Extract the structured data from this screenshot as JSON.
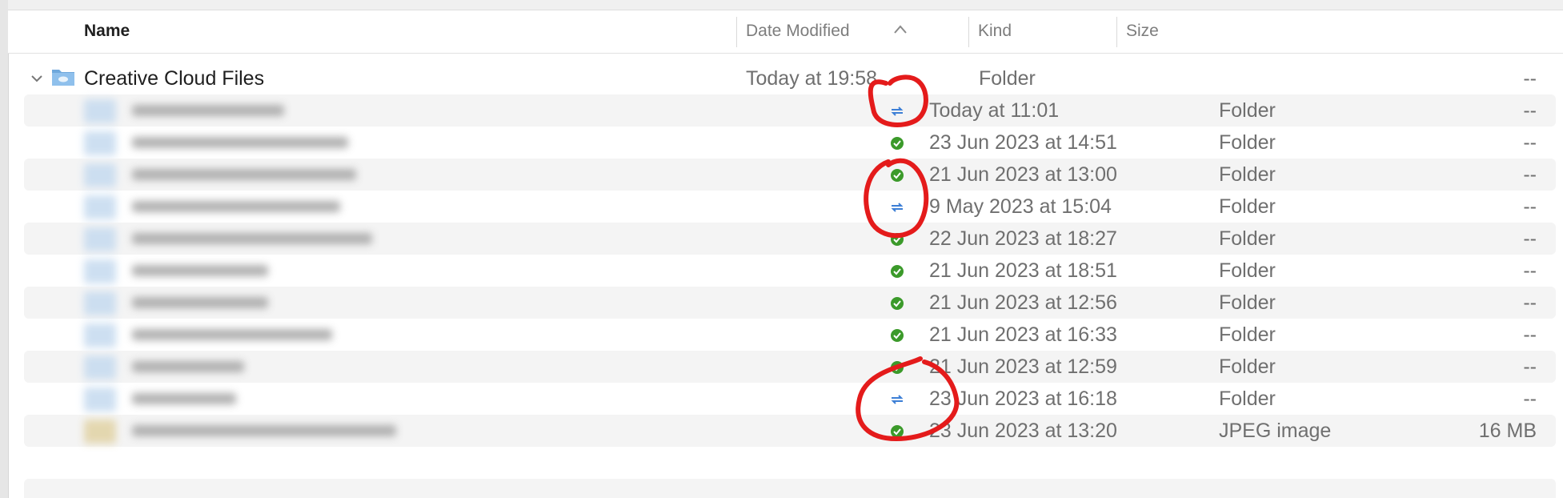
{
  "columns": {
    "name": "Name",
    "date_modified": "Date Modified",
    "kind": "Kind",
    "size": "Size",
    "sort_indicator": "^"
  },
  "root": {
    "name": "Creative Cloud Files",
    "date": "Today at 19:58",
    "kind": "Folder",
    "size": "--",
    "disclosure": "⌄",
    "icon": "cloud-folder-icon"
  },
  "rows": [
    {
      "status": "syncing",
      "date": "Today at 11:01",
      "kind": "Folder",
      "size": "--"
    },
    {
      "status": "synced",
      "date": "23 Jun 2023 at 14:51",
      "kind": "Folder",
      "size": "--"
    },
    {
      "status": "synced",
      "date": "21 Jun 2023 at 13:00",
      "kind": "Folder",
      "size": "--"
    },
    {
      "status": "syncing",
      "date": "9 May 2023 at 15:04",
      "kind": "Folder",
      "size": "--"
    },
    {
      "status": "synced",
      "date": "22 Jun 2023 at 18:27",
      "kind": "Folder",
      "size": "--"
    },
    {
      "status": "synced",
      "date": "21 Jun 2023 at 18:51",
      "kind": "Folder",
      "size": "--"
    },
    {
      "status": "synced",
      "date": "21 Jun 2023 at 12:56",
      "kind": "Folder",
      "size": "--"
    },
    {
      "status": "synced",
      "date": "21 Jun 2023 at 16:33",
      "kind": "Folder",
      "size": "--"
    },
    {
      "status": "synced",
      "date": "21 Jun 2023 at 12:59",
      "kind": "Folder",
      "size": "--"
    },
    {
      "status": "syncing",
      "date": "23 Jun 2023 at 16:18",
      "kind": "Folder",
      "size": "--"
    },
    {
      "status": "synced",
      "date": "23 Jun 2023 at 13:20",
      "kind": "JPEG image",
      "size": "16 MB"
    }
  ],
  "colors": {
    "synced": "#3b9a2a",
    "syncing": "#3d7fd6",
    "annotation": "#e41b1b"
  }
}
